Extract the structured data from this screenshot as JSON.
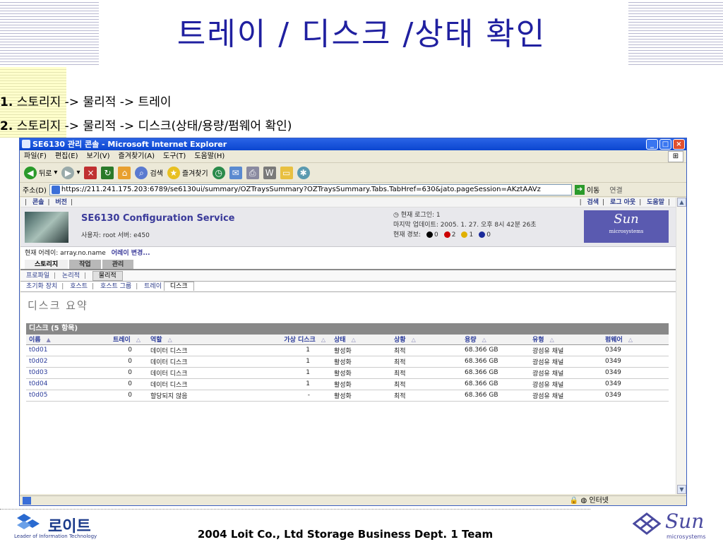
{
  "slide": {
    "title": "트레이 / 디스크 /상태 확인",
    "step1_num": "1.",
    "step1_text": " 스토리지 -> 물리적 -> 트레이",
    "step2_num": "2.",
    "step2_text": " 스토리지 -> 물리적 -> 디스크(상태/용량/펌웨어 확인)",
    "footer": "2004 Loit Co., Ltd Storage Business Dept. 1 Team",
    "loit_logo_text": "로이트",
    "loit_tagline": "Leader of Information Technology",
    "sun_logo_text": "Sun",
    "sun_logo_sub": "microsystems"
  },
  "browser": {
    "title": "SE6130 관리 콘솔 - Microsoft Internet Explorer",
    "menu": [
      "파일(F)",
      "편집(E)",
      "보기(V)",
      "즐겨찾기(A)",
      "도구(T)",
      "도움말(H)"
    ],
    "toolbar": {
      "back": "뒤로",
      "search": "검색",
      "favorites": "즐겨찾기"
    },
    "address_label": "주소(D)",
    "address": "https://211.241.175.203:6789/se6130ui/summary/OZTraysSummary?OZTraysSummary.Tabs.TabHref=630&jato.pageSession=AKztAAVz",
    "go_label": "이동",
    "links_label": "연결",
    "status_zone": "인터넷"
  },
  "app": {
    "top_left": [
      "콘솔",
      "버전"
    ],
    "top_right": [
      "검색",
      "로그 아웃",
      "도움말"
    ],
    "product": "SE6130 Configuration Service",
    "user_line": "사용자: root   서버: e450",
    "current_login": "현재 로그인: 1",
    "last_update": "마지막 업데이트: 2005. 1. 27. 오후 8시 42분 26초",
    "alarm_label": "현재 경보:",
    "alarms": [
      {
        "count": "0",
        "color": "#000000"
      },
      {
        "count": "2",
        "color": "#cc0000"
      },
      {
        "count": "1",
        "color": "#e0b000"
      },
      {
        "count": "0",
        "color": "#1a2a9a"
      }
    ],
    "sun_box": "Sun",
    "sun_box_sub": "microsystems",
    "current_array_label": "현재 어레이: array.no.name",
    "change_array": "어레이 변경...",
    "tabs1": [
      "스토리지",
      "작업",
      "관리"
    ],
    "tabs2": [
      "프로파일",
      "논리적",
      "물리적"
    ],
    "tabs3": [
      "초기화 장치",
      "호스트",
      "호스트 그룹",
      "트레이",
      "디스크"
    ],
    "page_title": "디스크 요약",
    "table_title": "디스크 (5 항목)",
    "columns": [
      "이름",
      "트레이",
      "역할",
      "가상 디스크",
      "상태",
      "상황",
      "용량",
      "유형",
      "펌웨어"
    ],
    "rows": [
      [
        "t0d01",
        "0",
        "데이터 디스크",
        "1",
        "활성화",
        "최적",
        "68.366 GB",
        "광섬유 채널",
        "0349"
      ],
      [
        "t0d02",
        "0",
        "데이터 디스크",
        "1",
        "활성화",
        "최적",
        "68.366 GB",
        "광섬유 채널",
        "0349"
      ],
      [
        "t0d03",
        "0",
        "데이터 디스크",
        "1",
        "활성화",
        "최적",
        "68.366 GB",
        "광섬유 채널",
        "0349"
      ],
      [
        "t0d04",
        "0",
        "데이터 디스크",
        "1",
        "활성화",
        "최적",
        "68.366 GB",
        "광섬유 채널",
        "0349"
      ],
      [
        "t0d05",
        "0",
        "할당되지 않음",
        "-",
        "활성화",
        "최적",
        "68.366 GB",
        "광섬유 채널",
        "0349"
      ]
    ]
  }
}
